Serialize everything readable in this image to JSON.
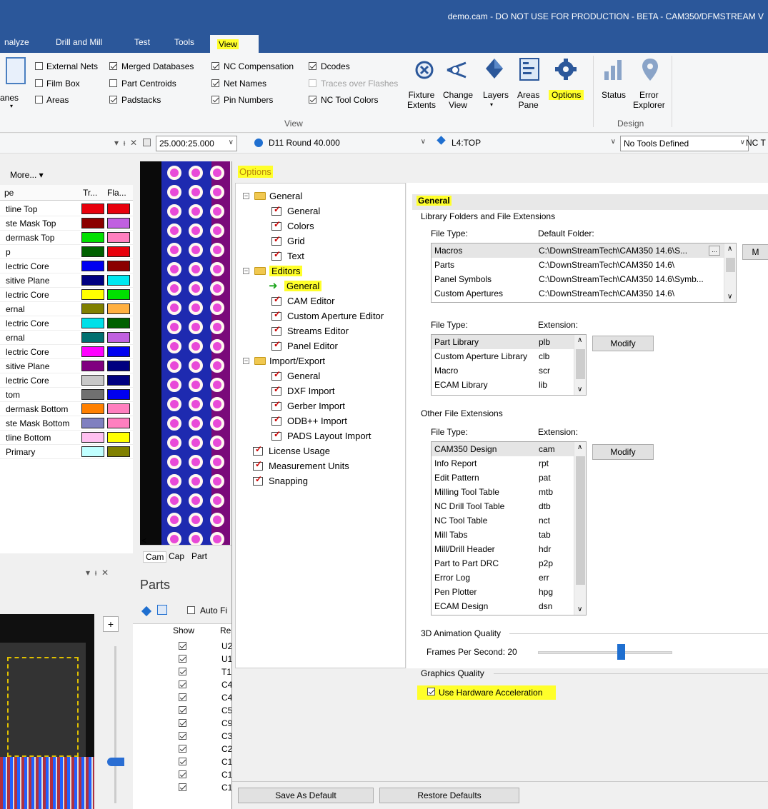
{
  "window": {
    "title": "demo.cam - DO NOT USE FOR PRODUCTION - BETA - CAM350/DFMSTREAM V"
  },
  "ribbon_tabs": [
    "nalyze",
    "Drill and Mill",
    "Test",
    "Tools",
    "View"
  ],
  "ribbon": {
    "partial_left": "anes",
    "checks": [
      {
        "label": "External Nets",
        "checked": false
      },
      {
        "label": "Film Box",
        "checked": false
      },
      {
        "label": "Areas",
        "checked": false
      },
      {
        "label": "Merged Databases",
        "checked": true
      },
      {
        "label": "Part Centroids",
        "checked": false
      },
      {
        "label": "Padstacks",
        "checked": true
      },
      {
        "label": "NC Compensation",
        "checked": true
      },
      {
        "label": "Net Names",
        "checked": true
      },
      {
        "label": "Pin Numbers",
        "checked": true
      },
      {
        "label": "Dcodes",
        "checked": true
      },
      {
        "label": "Traces over Flashes",
        "checked": false
      },
      {
        "label": "NC Tool Colors",
        "checked": true
      }
    ],
    "view_group": "View",
    "design_group": "Design",
    "buttons": {
      "fixture": "Fixture\nExtents",
      "change_view": "Change\nView",
      "layers": "Layers",
      "areas_pane": "Areas\nPane",
      "options": "Options",
      "status": "Status",
      "error_explorer": "Error\nExplorer"
    }
  },
  "toolbar": {
    "grid": "25.000:25.000",
    "dcode": "D11  Round 40.000",
    "layer": "L4:TOP",
    "tools": "No Tools Defined",
    "nc": "NC T"
  },
  "left_panel": {
    "more": "More...",
    "col_type": "pe",
    "col_tr": "Tr...",
    "col_fla": "Fla...",
    "rows": [
      {
        "name": "tline Top",
        "c1": "#e8000c",
        "c2": "#e8000c"
      },
      {
        "name": "ste Mask Top",
        "c1": "#8b0000",
        "c2": "#c060e0"
      },
      {
        "name": "dermask Top",
        "c1": "#00e000",
        "c2": "#ff7fbf"
      },
      {
        "name": "p",
        "c1": "#006000",
        "c2": "#e8000c"
      },
      {
        "name": "lectric Core",
        "c1": "#0000f0",
        "c2": "#8b0000"
      },
      {
        "name": "sitive Plane",
        "c1": "#000080",
        "c2": "#00e8f0"
      },
      {
        "name": "lectric Core",
        "c1": "#ffff00",
        "c2": "#00e000"
      },
      {
        "name": "ernal",
        "c1": "#808000",
        "c2": "#ffb040"
      },
      {
        "name": "lectric Core",
        "c1": "#00e0e8",
        "c2": "#006000"
      },
      {
        "name": "ernal",
        "c1": "#007070",
        "c2": "#c060e0"
      },
      {
        "name": "lectric Core",
        "c1": "#ff00ff",
        "c2": "#0000f0"
      },
      {
        "name": "sitive Plane",
        "c1": "#800080",
        "c2": "#000080"
      },
      {
        "name": "lectric Core",
        "c1": "#c8c8c8",
        "c2": "#000080"
      },
      {
        "name": "tom",
        "c1": "#707070",
        "c2": "#0000f0"
      },
      {
        "name": "dermask Bottom",
        "c1": "#ff8000",
        "c2": "#ff7fbf"
      },
      {
        "name": "ste Mask Bottom",
        "c1": "#8080c0",
        "c2": "#ff7fbf"
      },
      {
        "name": "tline Bottom",
        "c1": "#ffc0f0",
        "c2": "#ffff00"
      },
      {
        "name": "Primary",
        "c1": "#c0ffff",
        "c2": "#808000"
      }
    ]
  },
  "bottom_tabs": [
    "Cam",
    "Cap",
    "Part"
  ],
  "parts": {
    "title": "Parts",
    "auto": "Auto Fi",
    "col_show": "Show",
    "col_ref": "Re",
    "refs": [
      "U2",
      "U1",
      "T1",
      "C4",
      "C4",
      "C5",
      "C9",
      "C3",
      "C2",
      "C1",
      "C1",
      "C1"
    ]
  },
  "options": {
    "title": "Options",
    "tree": [
      {
        "label": "General",
        "type": "folder",
        "level": 0
      },
      {
        "label": "General",
        "type": "leaf",
        "level": 1
      },
      {
        "label": "Colors",
        "type": "leaf",
        "level": 1
      },
      {
        "label": "Grid",
        "type": "leaf",
        "level": 1
      },
      {
        "label": "Text",
        "type": "leaf",
        "level": 1
      },
      {
        "label": "Editors",
        "type": "folder",
        "level": 0
      },
      {
        "label": "General",
        "type": "selected",
        "level": 1
      },
      {
        "label": "CAM Editor",
        "type": "leaf",
        "level": 1
      },
      {
        "label": "Custom Aperture Editor",
        "type": "leaf",
        "level": 1
      },
      {
        "label": "Streams Editor",
        "type": "leaf",
        "level": 1
      },
      {
        "label": "Panel Editor",
        "type": "leaf",
        "level": 1
      },
      {
        "label": "Import/Export",
        "type": "folder",
        "level": 0
      },
      {
        "label": "General",
        "type": "leaf",
        "level": 1
      },
      {
        "label": "DXF Import",
        "type": "leaf",
        "level": 1
      },
      {
        "label": "Gerber Import",
        "type": "leaf",
        "level": 1
      },
      {
        "label": "ODB++ Import",
        "type": "leaf",
        "level": 1
      },
      {
        "label": "PADS Layout Import",
        "type": "leaf",
        "level": 1
      },
      {
        "label": "License Usage",
        "type": "leaf",
        "level": 0
      },
      {
        "label": "Measurement Units",
        "type": "leaf",
        "level": 0
      },
      {
        "label": "Snapping",
        "type": "leaf",
        "level": 0
      }
    ],
    "section": "General",
    "lib_header": "Library Folders and File Extensions",
    "file_type": "File Type:",
    "default_folder": "Default Folder:",
    "extension": "Extension:",
    "folders": [
      {
        "type": "Macros",
        "path": "C:\\DownStreamTech\\CAM350 14.6\\S..."
      },
      {
        "type": "Parts",
        "path": "C:\\DownStreamTech\\CAM350 14.6\\"
      },
      {
        "type": "Panel Symbols",
        "path": "C:\\DownStreamTech\\CAM350 14.6\\Symb..."
      },
      {
        "type": "Custom Apertures",
        "path": "C:\\DownStreamTech\\CAM350 14.6\\"
      }
    ],
    "lib_ext": [
      {
        "type": "Part Library",
        "ext": "plb"
      },
      {
        "type": "Custom Aperture Library",
        "ext": "clb"
      },
      {
        "type": "Macro",
        "ext": "scr"
      },
      {
        "type": "ECAM Library",
        "ext": "lib"
      }
    ],
    "other_header": "Other File Extensions",
    "other_ext": [
      {
        "type": "CAM350 Design",
        "ext": "cam"
      },
      {
        "type": "Info Report",
        "ext": "rpt"
      },
      {
        "type": "Edit Pattern",
        "ext": "pat"
      },
      {
        "type": "Milling Tool Table",
        "ext": "mtb"
      },
      {
        "type": "NC Drill Tool Table",
        "ext": "dtb"
      },
      {
        "type": "NC Tool Table",
        "ext": "nct"
      },
      {
        "type": "Mill Tabs",
        "ext": "tab"
      },
      {
        "type": "Mill/Drill Header",
        "ext": "hdr"
      },
      {
        "type": "Part to Part DRC",
        "ext": "p2p"
      },
      {
        "type": "Error Log",
        "ext": "err"
      },
      {
        "type": "Pen Plotter",
        "ext": "hpg"
      },
      {
        "type": "ECAM Design",
        "ext": "dsn"
      }
    ],
    "modify": "Modify",
    "m_partial": "M",
    "anim_header": "3D Animation Quality",
    "fps_label": "Frames Per Second: 20",
    "fps_slider": {
      "min": 0,
      "max": 60,
      "value": 20
    },
    "gfx_header": "Graphics Quality",
    "hw_accel": "Use Hardware Acceleration",
    "hw_checked": true,
    "save_default": "Save As Default",
    "restore_defaults": "Restore Defaults"
  }
}
